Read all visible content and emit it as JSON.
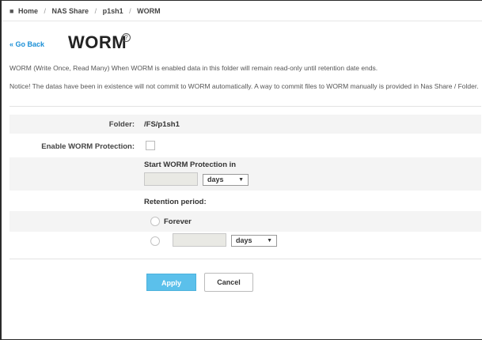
{
  "breadcrumb": {
    "home": "Home",
    "items": [
      "NAS Share",
      "p1sh1",
      "WORM"
    ]
  },
  "header": {
    "back_label": "« Go Back",
    "title": "WORM",
    "help_icon": "?"
  },
  "description": {
    "line1": "WORM (Write Once, Read Many) When WORM is enabled data in this folder will remain read-only until retention date ends.",
    "line2": "Notice! The datas have been in existence will not commit to WORM automatically. A way to commit files to WORM manually is provided in Nas Share / Folder."
  },
  "form": {
    "folder_label": "Folder:",
    "folder_value": "/FS/p1sh1",
    "enable_label": "Enable WORM Protection:",
    "enable_checked": false,
    "start_label": "Start WORM Protection in",
    "start_value": "",
    "start_unit": "days",
    "retention_label": "Retention period:",
    "forever_label": "Forever",
    "retention_value": "",
    "retention_unit": "days"
  },
  "buttons": {
    "apply": "Apply",
    "cancel": "Cancel"
  },
  "colors": {
    "accent": "#5bc0eb",
    "link": "#1a8fd6"
  }
}
